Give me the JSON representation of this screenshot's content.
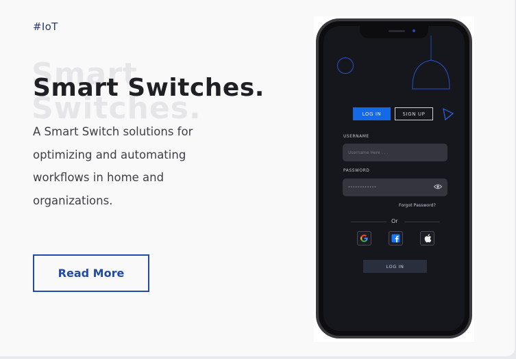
{
  "card": {
    "tag": "#IoT",
    "title_ghost": "Smart Switches.",
    "title": "Smart Switches.",
    "description": "A Smart Switch solutions for optimizing and automating workflows in home and organizations.",
    "read_more": "Read More"
  },
  "phone": {
    "tabs": {
      "login": "LOG IN",
      "signup": "SIGN UP"
    },
    "username": {
      "label": "USERNAME",
      "placeholder": "Username Here . . ."
    },
    "password": {
      "label": "PASSWORD",
      "value": "••••••••••••"
    },
    "forgot": "Forgot Password?",
    "or": "Or",
    "social": [
      "google-icon",
      "facebook-icon",
      "apple-icon"
    ],
    "login_button": "LOG IN"
  },
  "colors": {
    "accent": "#1f4aa8",
    "login_tab": "#1469e6",
    "screen_bg": "#16161d"
  }
}
